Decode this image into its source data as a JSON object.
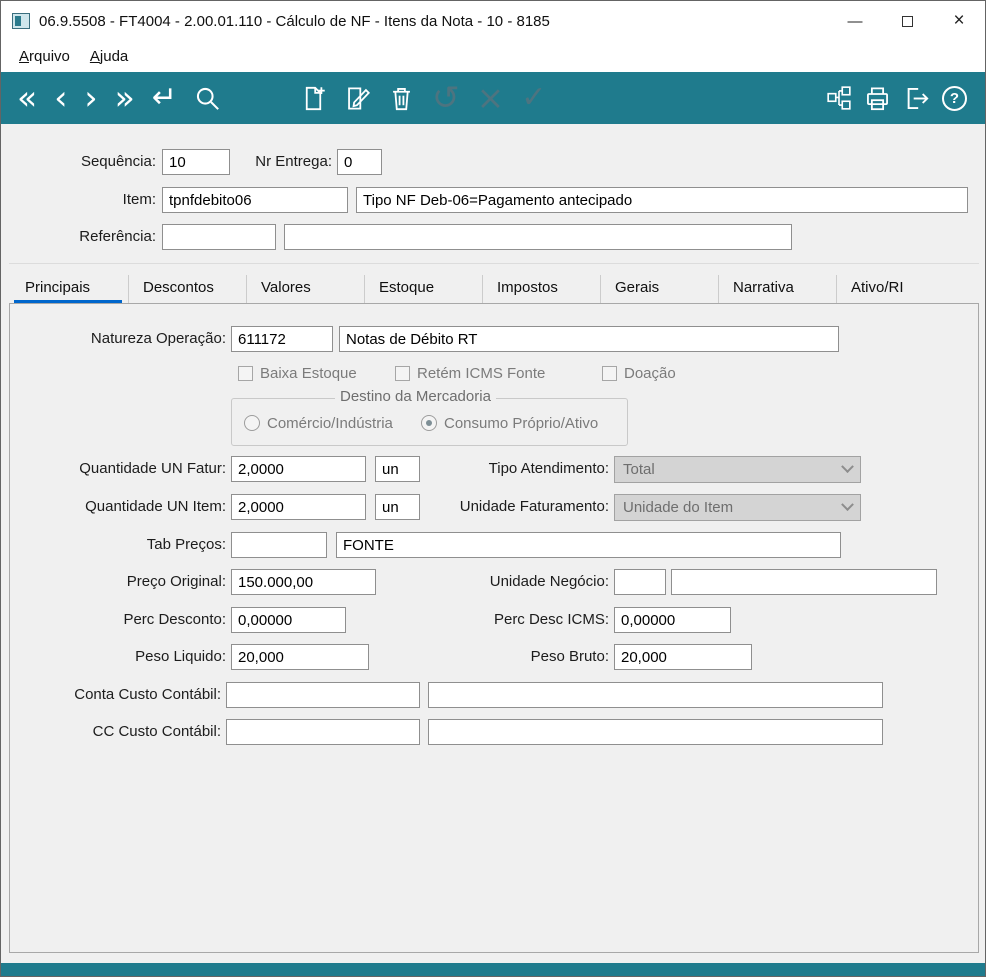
{
  "colors": {
    "accent": "#1f7b8d",
    "disabled_icon": "#4d7480",
    "tab_underline": "#0066cc"
  },
  "window": {
    "title": "06.9.5508 - FT4004 - 2.00.01.110 - Cálculo de NF - Itens da Nota - 10 - 8185",
    "minimize": "—",
    "close": "×"
  },
  "menu": {
    "arquivo": {
      "m": "A",
      "rest": "rquivo"
    },
    "ajuda": {
      "m": "A",
      "rest": "juda"
    }
  },
  "icons": {
    "first": "«",
    "previous": "‹",
    "next": "›",
    "last": "»",
    "enter": "↵",
    "undo": "↺",
    "cancel": "×",
    "confirm": "✓",
    "help": "?"
  },
  "header": {
    "sequencia_label": "Sequência:",
    "sequencia_value": "10",
    "nr_entrega_label": "Nr Entrega:",
    "nr_entrega_value": "0",
    "item_label": "Item:",
    "item_value": "tpnfdebito06",
    "item_desc": "Tipo NF Deb-06=Pagamento antecipado",
    "referencia_label": "Referência:",
    "referencia_value": "",
    "referencia_desc": ""
  },
  "tabs": [
    {
      "label": "Principais"
    },
    {
      "label": "Descontos"
    },
    {
      "label": "Valores"
    },
    {
      "label": "Estoque"
    },
    {
      "label": "Impostos"
    },
    {
      "label": "Gerais"
    },
    {
      "label": "Narrativa"
    },
    {
      "label": "Ativo/RI"
    }
  ],
  "form": {
    "natureza_label": "Natureza Operação:",
    "natureza_code": "611172",
    "natureza_desc": "Notas de Débito RT",
    "chk_baixa": "Baixa Estoque",
    "chk_retem": "Retém ICMS Fonte",
    "chk_doacao": "Doação",
    "destino_title": "Destino da Mercadoria",
    "radio_comercio": "Comércio/Indústria",
    "radio_consumo": "Consumo Próprio/Ativo",
    "qtd_fatur_label": "Quantidade UN Fatur:",
    "qtd_fatur_value": "2,0000",
    "qtd_fatur_un": "un",
    "tipo_atend_label": "Tipo Atendimento:",
    "tipo_atend_value": "Total",
    "qtd_item_label": "Quantidade UN Item:",
    "qtd_item_value": "2,0000",
    "qtd_item_un": "un",
    "unid_fat_label": "Unidade Faturamento:",
    "unid_fat_value": "Unidade do Item",
    "tab_precos_label": "Tab Preços:",
    "tab_precos_value": "",
    "tab_precos_desc": "FONTE",
    "preco_label": "Preço Original:",
    "preco_value": "150.000,00",
    "un_negocio_label": "Unidade Negócio:",
    "un_negocio_code": "",
    "un_negocio_desc": "",
    "perc_desc_label": "Perc Desconto:",
    "perc_desc_value": "0,00000",
    "perc_icms_label": "Perc Desc ICMS:",
    "perc_icms_value": "0,00000",
    "peso_liq_label": "Peso Liquido:",
    "peso_liq_value": "20,000",
    "peso_bruto_label": "Peso Bruto:",
    "peso_bruto_value": "20,000",
    "conta_label": "Conta Custo Contábil:",
    "conta_code": "",
    "conta_desc": "",
    "cc_label": "CC Custo Contábil:",
    "cc_code": "",
    "cc_desc": ""
  }
}
